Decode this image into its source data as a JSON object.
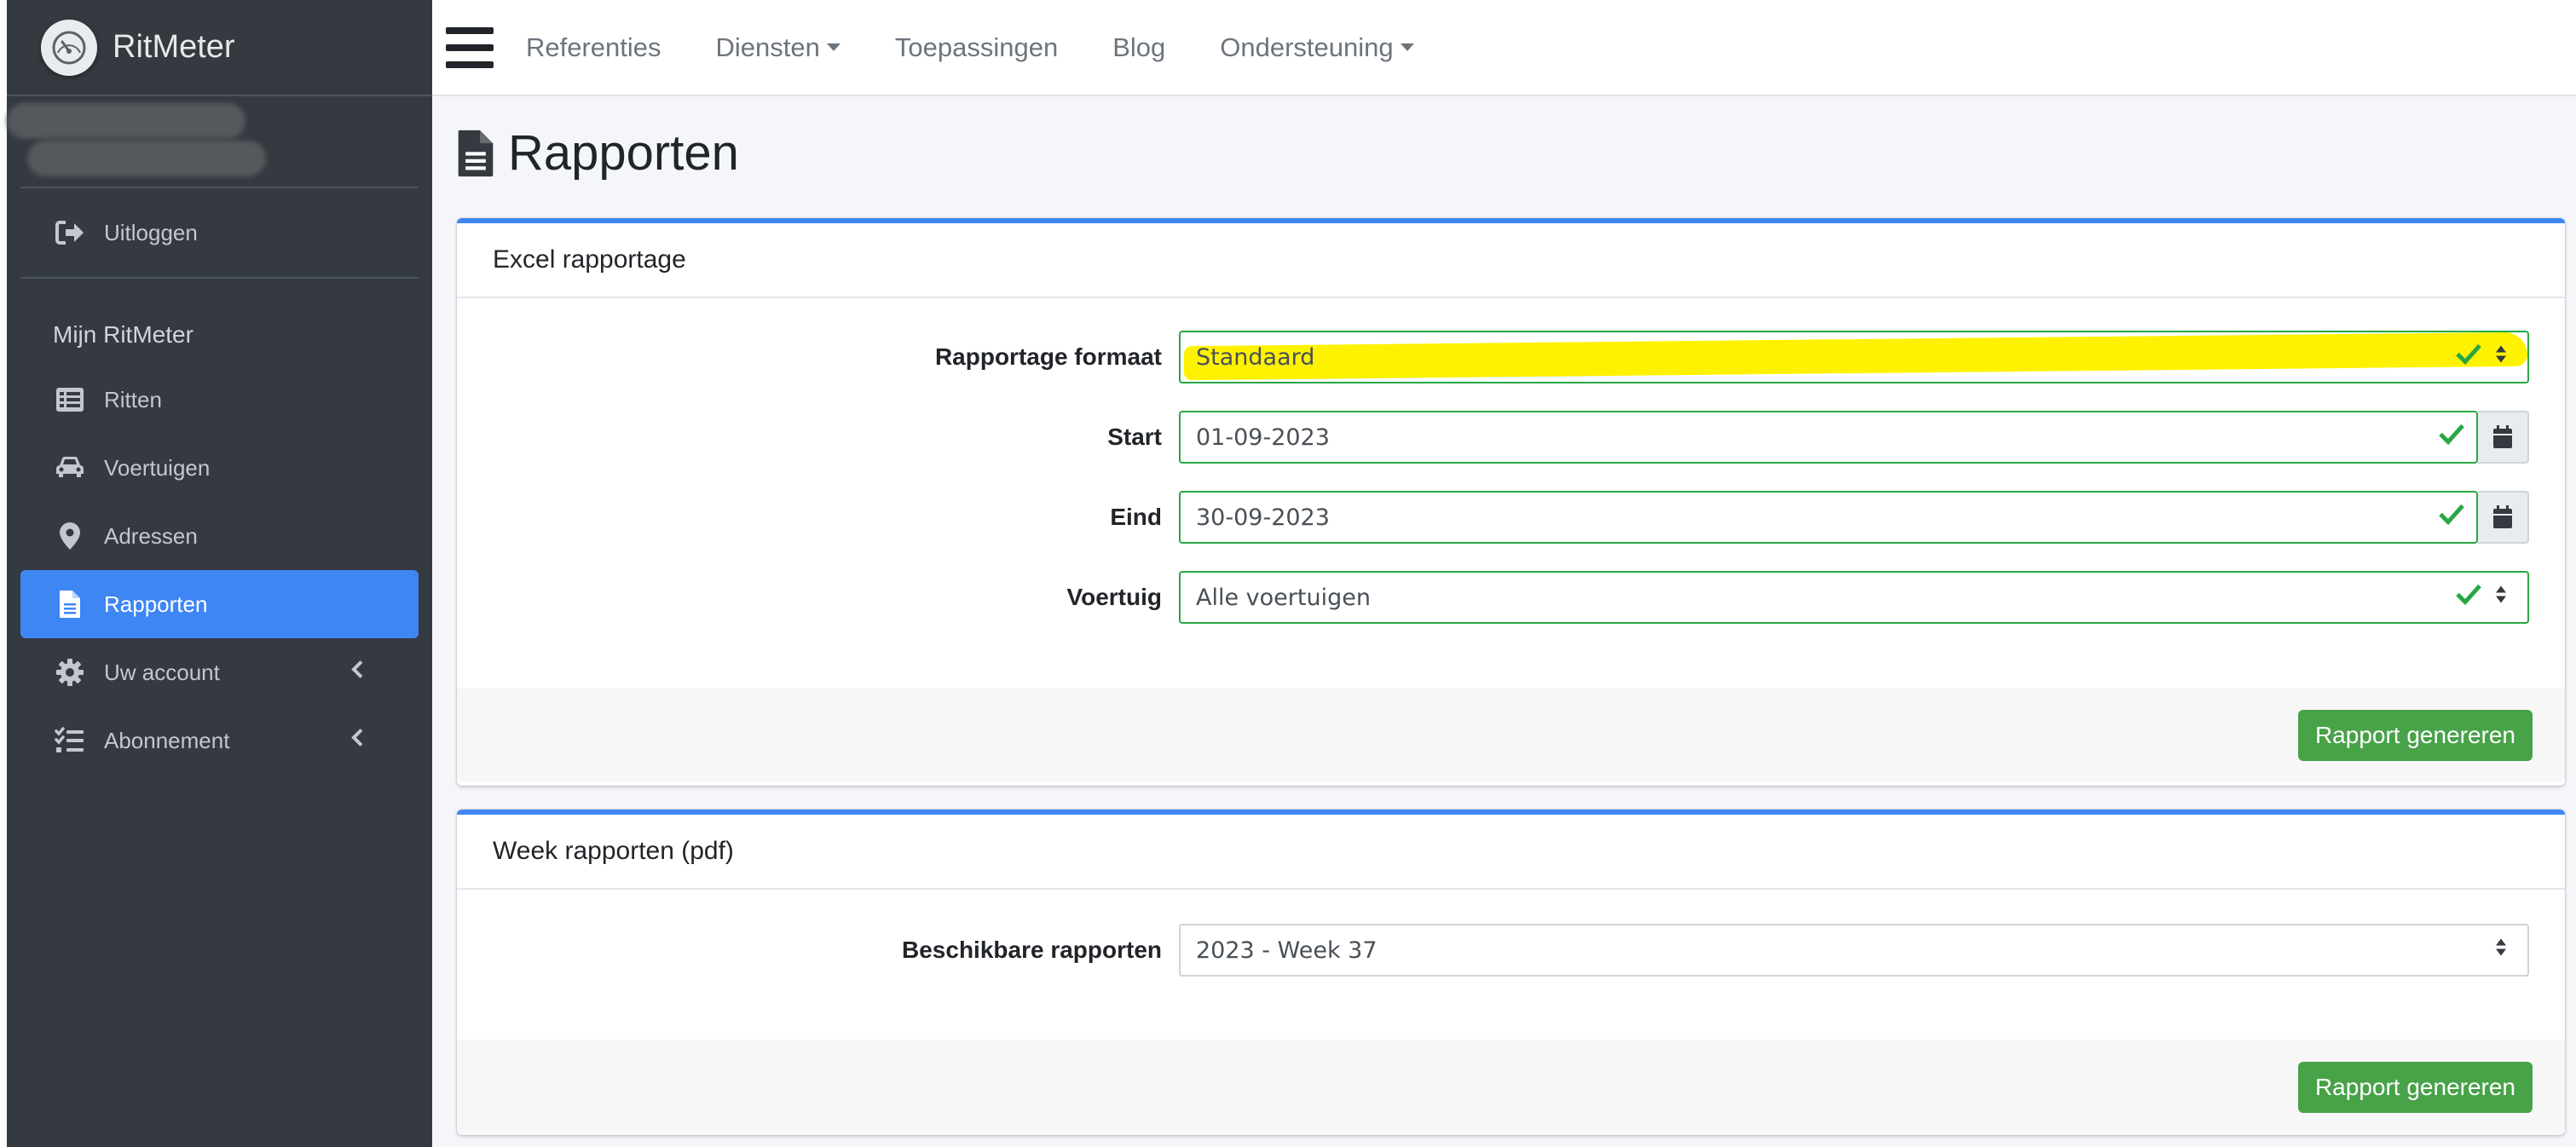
{
  "sidebar": {
    "brand": "RitMeter",
    "logout": "Uitloggen",
    "section_header": "Mijn RitMeter",
    "items": [
      {
        "label": "Ritten"
      },
      {
        "label": "Voertuigen"
      },
      {
        "label": "Adressen"
      },
      {
        "label": "Rapporten"
      },
      {
        "label": "Uw account"
      },
      {
        "label": "Abonnement"
      }
    ]
  },
  "topnav": {
    "items": [
      "Referenties",
      "Diensten",
      "Toepassingen",
      "Blog",
      "Ondersteuning"
    ]
  },
  "page": {
    "title": "Rapporten"
  },
  "excel": {
    "header": "Excel rapportage",
    "format_label": "Rapportage formaat",
    "format_value": "Standaard",
    "start_label": "Start",
    "start_value": "01-09-2023",
    "end_label": "Eind",
    "end_value": "30-09-2023",
    "vehicle_label": "Voertuig",
    "vehicle_value": "Alle voertuigen",
    "button": "Rapport genereren"
  },
  "week": {
    "header": "Week rapporten (pdf)",
    "available_label": "Beschikbare rapporten",
    "available_value": "2023 - Week 37",
    "button": "Rapport genereren"
  },
  "colors": {
    "sidebar_bg": "#343a40",
    "active": "#3f86f5",
    "success": "#28a745",
    "button": "#47a248",
    "highlight": "#fff200"
  }
}
